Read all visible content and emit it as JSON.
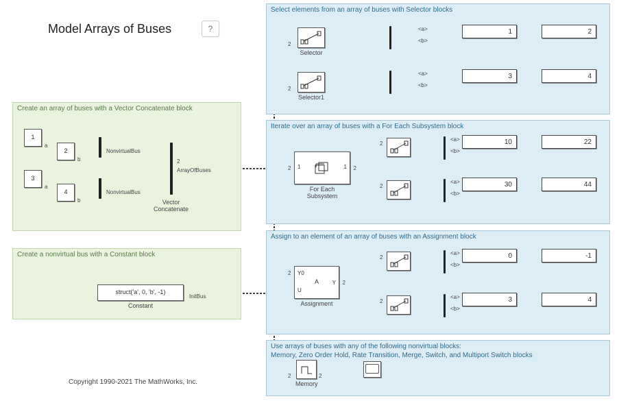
{
  "title": "Model Arrays of Buses",
  "copyright": "Copyright 1990-2021 The MathWorks, Inc.",
  "help_label": "?",
  "regions": {
    "create_array": "Create an array of buses with a Vector Concatenate block",
    "create_nonvirtual": "Create a nonvirtual bus with a Constant block",
    "select": "Select elements from an array of buses with Selector blocks",
    "iterate": "Iterate over an array of buses with a For Each Subsystem block",
    "assign": "Assign to an element of an array of buses with an Assignment block",
    "use": "Use arrays of buses with any of the following nonvirtual blocks:\nMemory, Zero Order Hold, Rate Transition, Merge, Switch, and Multiport Switch blocks"
  },
  "constants": {
    "c1": "1",
    "c2": "2",
    "c3": "3",
    "c4": "4"
  },
  "ports": {
    "a": "a",
    "b": "b"
  },
  "labels": {
    "nonvirtualbus": "NonvirtualBus",
    "vector_concat": "Vector\nConcatenate",
    "array_of_buses": "ArrayOfBuses",
    "constant": "Constant",
    "initbus": "InitBus",
    "struct": "struct('a', 0, 'b', -1)",
    "selector": "Selector",
    "selector1": "Selector1",
    "for_each": "For Each\nSubsystem",
    "assignment": "Assignment",
    "memory": "Memory",
    "y0": "Y0",
    "u": "U",
    "a_block": "A",
    "y": "Y",
    "bus_a": "<a>",
    "bus_b": "<b>"
  },
  "dim": {
    "two": "2",
    "one": "1"
  },
  "displays": {
    "sel_a1": "1",
    "sel_b1": "2",
    "sel_a2": "3",
    "sel_b2": "4",
    "it_a1": "10",
    "it_b1": "22",
    "it_a2": "30",
    "it_b2": "44",
    "as_a1": "0",
    "as_b1": "-1",
    "as_a2": "3",
    "as_b2": "4"
  }
}
